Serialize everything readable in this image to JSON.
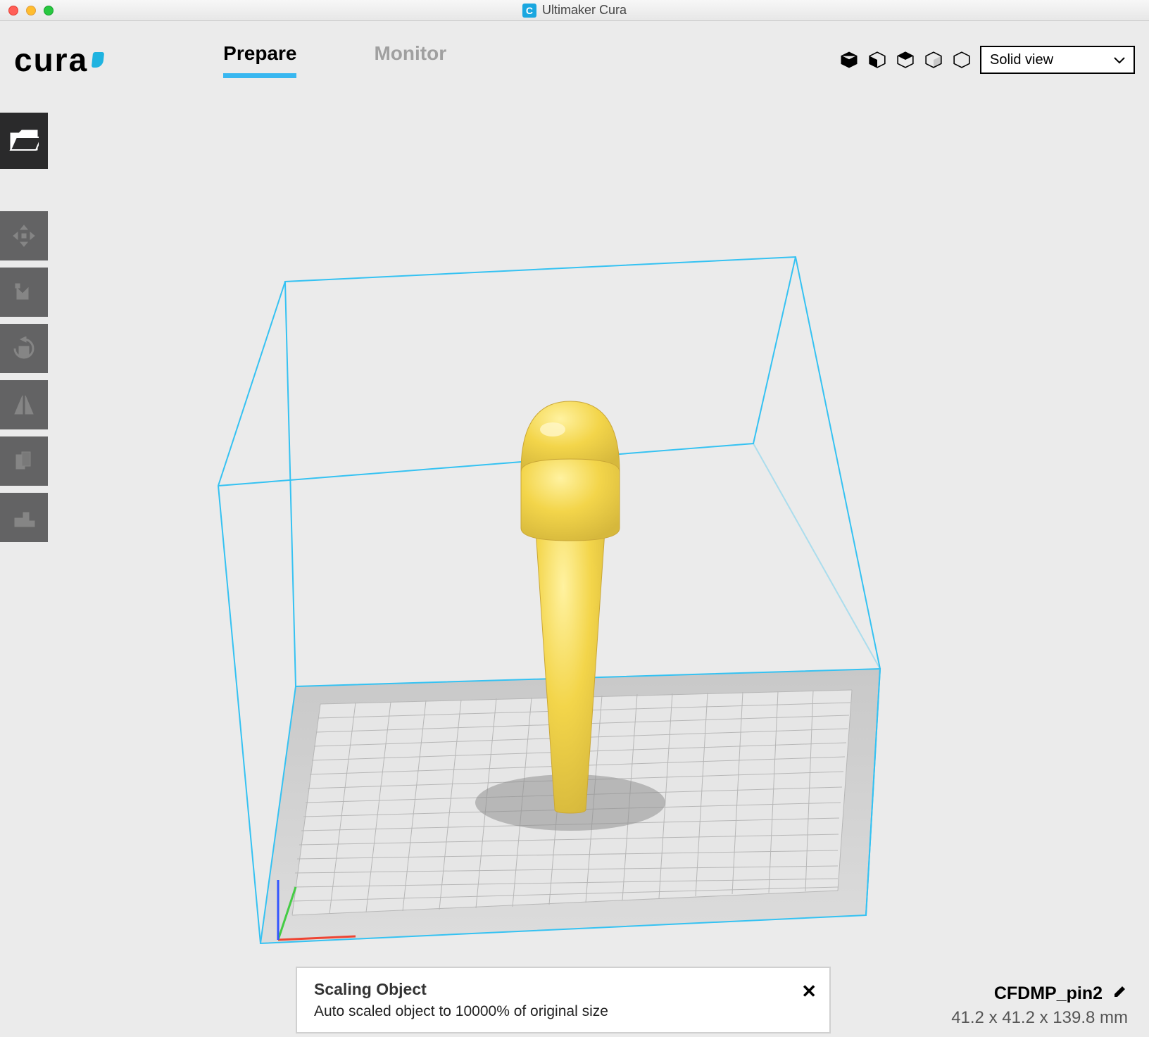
{
  "window": {
    "title": "Ultimaker Cura"
  },
  "header": {
    "logo_text": "cura",
    "tabs": [
      {
        "label": "Prepare",
        "active": true
      },
      {
        "label": "Monitor",
        "active": false
      }
    ],
    "view_select": {
      "label": "Solid view"
    }
  },
  "toast": {
    "title": "Scaling Object",
    "message": "Auto scaled object to 10000% of original size",
    "close_label": "✕"
  },
  "object": {
    "name": "CFDMP_pin2",
    "dimensions": "41.2 x 41.2 x 139.8 mm"
  },
  "colors": {
    "accent": "#38b7f0",
    "model": "#f3d54a",
    "model_shadow": "#d9b83f",
    "build_wire": "#35c2f2"
  }
}
